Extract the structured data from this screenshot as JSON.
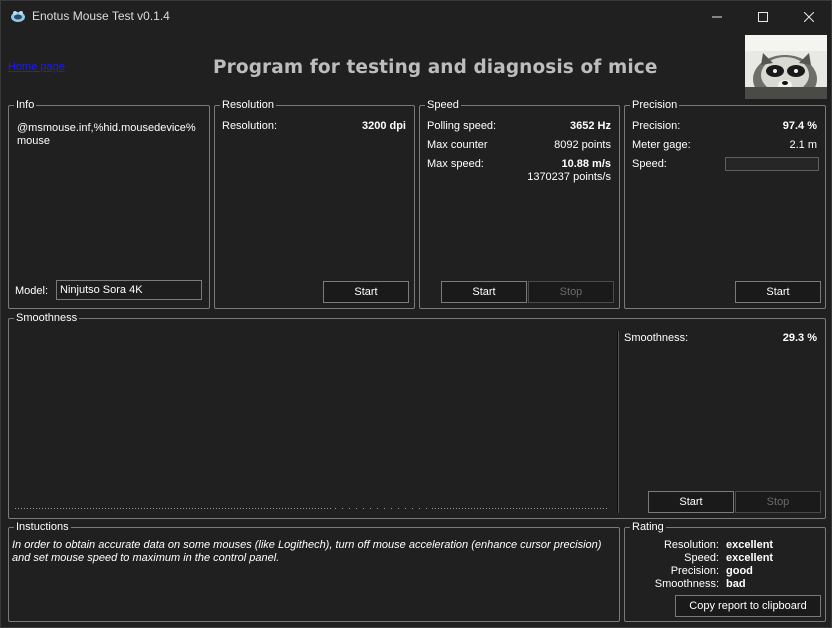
{
  "window": {
    "title": "Enotus Mouse Test v0.1.4"
  },
  "header": {
    "home_link": "Home page",
    "headline": "Program for testing and diagnosis of mice"
  },
  "info": {
    "legend": "Info",
    "device_line1": "@msmouse.inf,%hid.mousedevice%",
    "device_line2": "mouse",
    "model_label": "Model:",
    "model_value": "Ninjutso Sora 4K"
  },
  "resolution": {
    "legend": "Resolution",
    "label": "Resolution:",
    "value": "3200 dpi",
    "start_label": "Start"
  },
  "speed": {
    "legend": "Speed",
    "polling_label": "Polling speed:",
    "polling_value": "3652 Hz",
    "counter_label": "Max counter",
    "counter_value": "8092 points",
    "max_speed_label": "Max  speed:",
    "max_speed_value": "10.88 m/s",
    "max_speed_points": "1370237 points/s",
    "start_label": "Start",
    "stop_label": "Stop"
  },
  "precision": {
    "legend": "Precision",
    "precision_label": "Precision:",
    "precision_value": "97.4 %",
    "gage_label": "Meter gage:",
    "gage_value": "2.1 m",
    "speed_label": "Speed:",
    "speed_progress": 0,
    "start_label": "Start"
  },
  "smoothness": {
    "legend": "Smoothness",
    "label": "Smoothness:",
    "value": "29.3 %",
    "start_label": "Start",
    "stop_label": "Stop"
  },
  "instructions": {
    "legend": "Instuctions",
    "text": "In order to obtain accurate data on some mouses (like Logithech), turn off mouse acceleration (enhance cursor precision) and set mouse speed to maximum in the control panel."
  },
  "rating": {
    "legend": "Rating",
    "items": [
      {
        "label": "Resolution:",
        "value": "excellent"
      },
      {
        "label": "Speed:",
        "value": "excellent"
      },
      {
        "label": "Precision:",
        "value": "good"
      },
      {
        "label": "Smoothness:",
        "value": "bad"
      }
    ],
    "copy_label": "Copy report to clipboard"
  },
  "colors": {
    "background": "#202020",
    "border": "#7a7a7a",
    "link": "#1a1aff",
    "headline": "#bdbdbd",
    "disabled_text": "#6a6a6a"
  },
  "icons": [
    "raccoon-app-icon",
    "minimize-icon",
    "maximize-icon",
    "close-icon"
  ]
}
